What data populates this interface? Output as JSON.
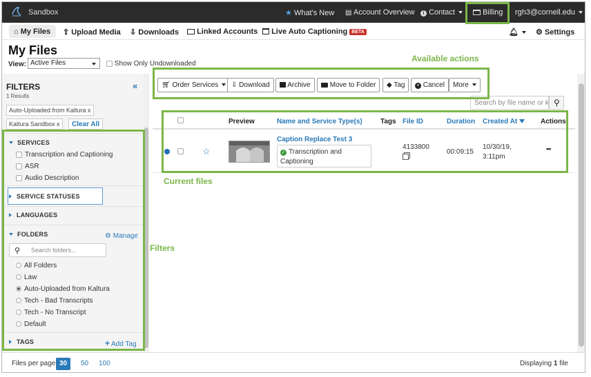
{
  "app": {
    "brand": "Sandbox",
    "nav": {
      "whats_new": "What's New",
      "account_overview": "Account Overview",
      "contact": "Contact",
      "billing": "Billing",
      "user": "rgh3@cornell.edu"
    },
    "subnav": {
      "my_files": "My Files",
      "upload_media": "Upload Media",
      "downloads": "Downloads",
      "linked_accounts": "Linked Accounts",
      "live_auto_captioning": "Live Auto Captioning",
      "beta": "BETA",
      "settings": "Settings"
    }
  },
  "page": {
    "title": "My Files",
    "view_label": "View:",
    "view_value": "Active Files",
    "show_undownloaded": "Show Only Undownloaded"
  },
  "filters": {
    "title": "FILTERS",
    "results": "1 Results",
    "chips": [
      "Auto-Uploaded from Kaltura x",
      "Kaltura Sandbox x"
    ],
    "clear_all": "Clear All",
    "services": {
      "label": "SERVICES",
      "options": [
        "Transcription and Captioning",
        "ASR",
        "Audio Description"
      ]
    },
    "service_statuses": "SERVICE STATUSES",
    "languages": "LANGUAGES",
    "folders": {
      "label": "FOLDERS",
      "manage": "Manage",
      "search_placeholder": "Search folders...",
      "options": [
        "All Folders",
        "Law",
        "Auto-Uploaded from Kaltura",
        "Tech - Bad Transcripts",
        "Tech - No Transcript",
        "Default"
      ]
    },
    "tags": {
      "label": "TAGS",
      "add": "Add Tag"
    }
  },
  "toolbar": {
    "order_services": "Order Services",
    "download": "Download",
    "archive": "Archive",
    "move_to_folder": "Move to Folder",
    "tag": "Tag",
    "cancel": "Cancel",
    "more": "More"
  },
  "search": {
    "placeholder": "Search by file name or keyword"
  },
  "table": {
    "headers": {
      "preview": "Preview",
      "name": "Name and Service Type(s)",
      "tags": "Tags",
      "file_id": "File ID",
      "duration": "Duration",
      "created_at": "Created At",
      "actions": "Actions"
    },
    "rows": [
      {
        "name": "Caption Replace Test 3",
        "service_line1": "Transcription and",
        "service_line2": "Captioning",
        "file_id": "4133800",
        "duration": "00:09:15",
        "created_line1": "10/30/19,",
        "created_line2": "3:11pm",
        "actions": "•••"
      }
    ]
  },
  "footer": {
    "files_per_page": "Files per page:",
    "pages": [
      "30",
      "50",
      "100"
    ],
    "displaying_prefix": "Displaying",
    "displaying_count": "1",
    "displaying_suffix": "file"
  },
  "annotations": {
    "available_actions": "Available actions",
    "current_files": "Current files",
    "filters": "Filters"
  },
  "colors": {
    "topnav_bg": "#2b2b2b",
    "link_blue": "#2a7ab8",
    "annotation_green": "#7ab648",
    "unread_dot": "#1f6fb8"
  }
}
